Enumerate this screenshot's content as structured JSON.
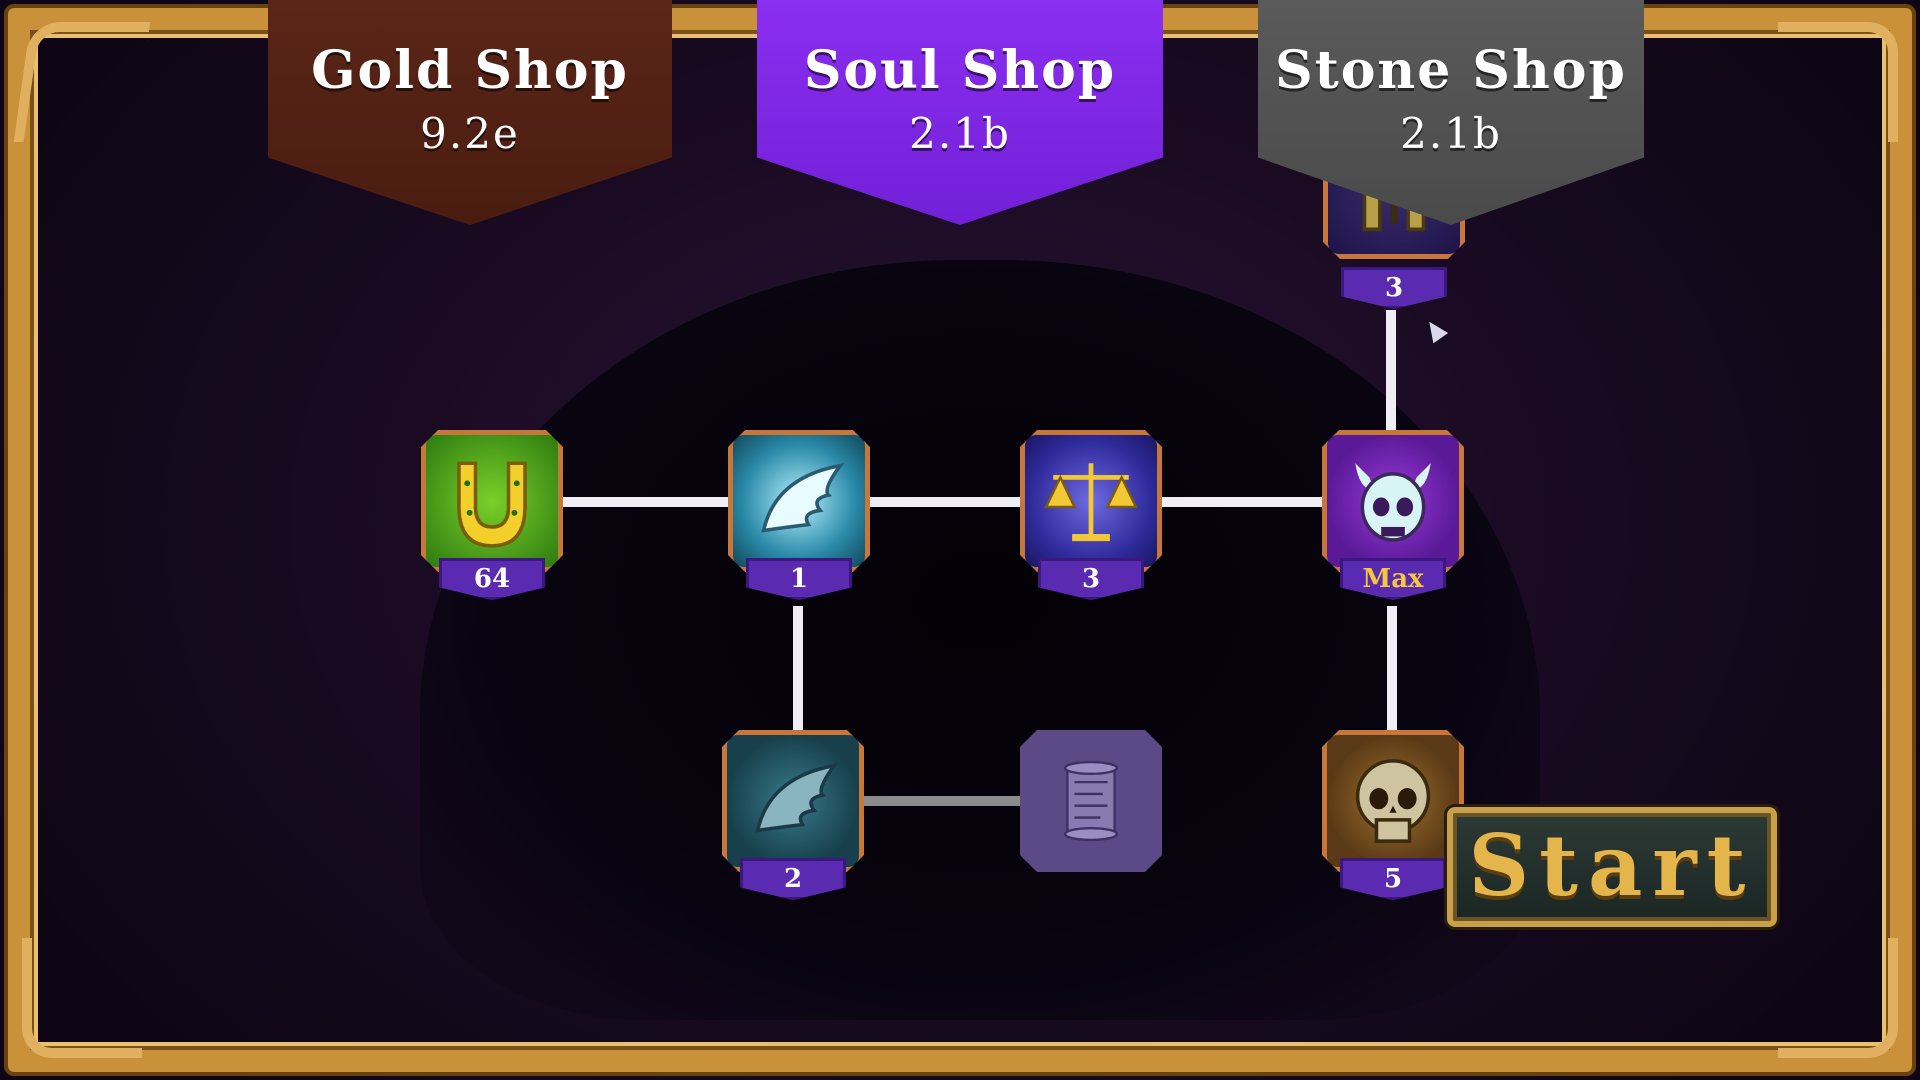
{
  "shops": [
    {
      "name": "Gold Shop",
      "value": "9.2e",
      "color": "#4f1f14"
    },
    {
      "name": "Soul Shop",
      "value": "2.1b",
      "color": "#7a25e0"
    },
    {
      "name": "Stone Shop",
      "value": "2.1b",
      "color": "#505050"
    }
  ],
  "nodes": {
    "horseshoe": {
      "icon": "horseshoe-icon",
      "level": "64"
    },
    "wing": {
      "icon": "wing-icon",
      "level": "1"
    },
    "scales": {
      "icon": "scales-icon",
      "level": "3"
    },
    "demon_skull": {
      "icon": "horned-skull-icon",
      "level": "Max"
    },
    "helmet": {
      "icon": "helmet-icon",
      "level": "3"
    },
    "wing_dark": {
      "icon": "wing-icon",
      "level": "2"
    },
    "scroll": {
      "icon": "scroll-icon",
      "level": ""
    },
    "skull": {
      "icon": "skull-icon",
      "level": "5"
    }
  },
  "start_button": {
    "label": "Start"
  },
  "colors": {
    "frame": "#c8913a",
    "badge": "#5a2bb0",
    "max": "#f6c63c",
    "start_text": "#e4b54b"
  }
}
